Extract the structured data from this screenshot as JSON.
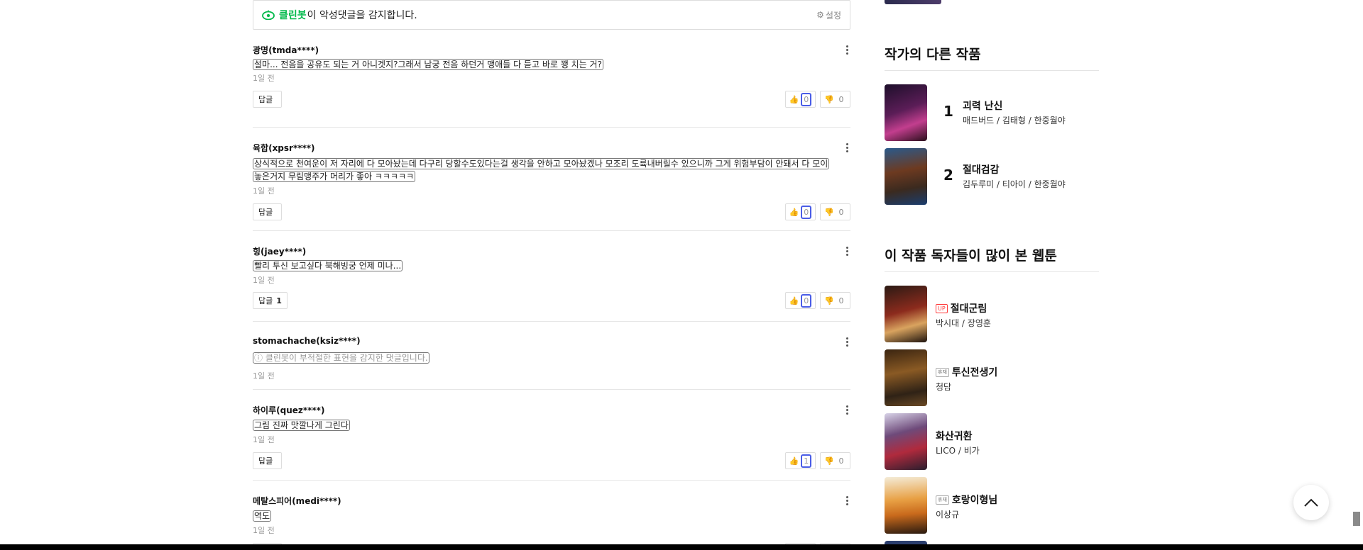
{
  "cleanbot": {
    "brand": "클린봇",
    "message": "이 악성댓글을 감지합니다.",
    "settings_label": "설정"
  },
  "comments": [
    {
      "author": "광명(tmda****)",
      "text": "설마... 전음을 공유도 되는 거 아니겟지?그래서 남궁 전음 하던거 맹애들 다 듣고 바로 꽹 치는 거?",
      "time": "1일 전",
      "reply_label": "답글",
      "reply_count": "",
      "likes": "0",
      "dislikes": "0"
    },
    {
      "author": "육합(xpsr****)",
      "text": "상식적으로 천여운이 저 자리에 다 모아놨는데 다구리 당할수도있다는걸 생각을 안하고 모아놨겠나 모조리 도륙내버릴수 있으니까 그게 위험부담이 안돼서 다 모이놓은거지 무림맹주가 머리가 좋아 ㅋㅋㅋㅋㅋ",
      "time": "1일 전",
      "reply_label": "답글",
      "reply_count": "",
      "likes": "0",
      "dislikes": "0"
    },
    {
      "author": "힝(jaey****)",
      "text": "빨리 투신 보고싶다 북해빙궁 언제 미나...",
      "time": "1일 전",
      "reply_label": "답글",
      "reply_count": "1",
      "likes": "0",
      "dislikes": "0"
    },
    {
      "author": "stomachache(ksiz****)",
      "blocked_brand": "클린봇",
      "blocked_text": "이 부적절한 표현을 감지한 댓글입니다.",
      "time": "1일 전"
    },
    {
      "author": "하이루(quez****)",
      "text": "그림 진짜 맛깔나게 그린다",
      "time": "1일 전",
      "reply_label": "답글",
      "reply_count": "",
      "likes": "1",
      "dislikes": "0"
    },
    {
      "author": "메탈스피어(medi****)",
      "text": "역도",
      "time": "1일 전",
      "reply_label": "답글",
      "reply_count": "",
      "likes": "0",
      "dislikes": "0"
    }
  ],
  "sidebar": {
    "other_works": {
      "title": "작가의 다른 작품",
      "items": [
        {
          "rank": "1",
          "title": "괴력 난신",
          "author": "매드버드 / 김태형 / 한중월야"
        },
        {
          "rank": "2",
          "title": "절대검감",
          "author": "김두루미 / 티아이 / 한중월야"
        }
      ]
    },
    "readers_also": {
      "title": "이 작품 독자들이 많이 본 웹툰",
      "items": [
        {
          "badge": "UP",
          "title": "절대군림",
          "author": "박시대 / 장영훈"
        },
        {
          "badge": "휴재",
          "title": "투신전생기",
          "author": "청담"
        },
        {
          "badge": "",
          "title": "화산귀환",
          "author": "LICO / 비가"
        },
        {
          "badge": "휴재",
          "title": "호랑이형님",
          "author": "이상규"
        }
      ]
    }
  },
  "colors": {
    "cleanbot_green": "#00b94a",
    "vote_highlight": "#4a5de6",
    "up_badge": "#ff3a3a"
  }
}
